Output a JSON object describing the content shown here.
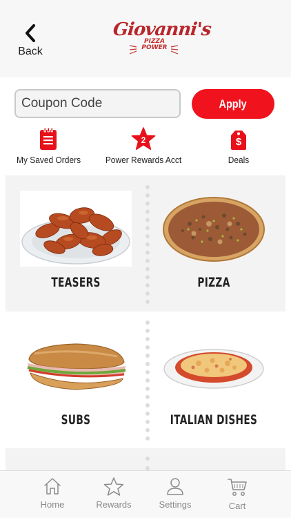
{
  "header": {
    "back_label": "Back",
    "logo_text": "Giovanni's",
    "logo_sub_1": "PIZZA",
    "logo_sub_2": "POWER"
  },
  "coupon": {
    "placeholder": "Coupon Code",
    "apply_label": "Apply"
  },
  "quick_actions": [
    {
      "label": "My Saved Orders",
      "icon": "clipboard-icon"
    },
    {
      "label": "Power Rewards Acct",
      "icon": "star-icon",
      "badge": "2"
    },
    {
      "label": "Deals",
      "icon": "price-tag-icon",
      "symbol": "$"
    }
  ],
  "categories": [
    {
      "label": "TEASERS",
      "image": "chicken-wings"
    },
    {
      "label": "PIZZA",
      "image": "pizza"
    },
    {
      "label": "SUBS",
      "image": "sub-sandwich"
    },
    {
      "label": "ITALIAN DISHES",
      "image": "baked-pasta"
    }
  ],
  "tabbar": [
    {
      "label": "Home",
      "icon": "home-icon"
    },
    {
      "label": "Rewards",
      "icon": "star-outline-icon"
    },
    {
      "label": "Settings",
      "icon": "person-icon"
    },
    {
      "label": "Cart",
      "icon": "cart-icon"
    }
  ],
  "colors": {
    "brand_red": "#f0121c",
    "logo_red": "#b8262b",
    "tab_grey": "#8a8a8a",
    "section_grey": "#f3f3f3"
  }
}
